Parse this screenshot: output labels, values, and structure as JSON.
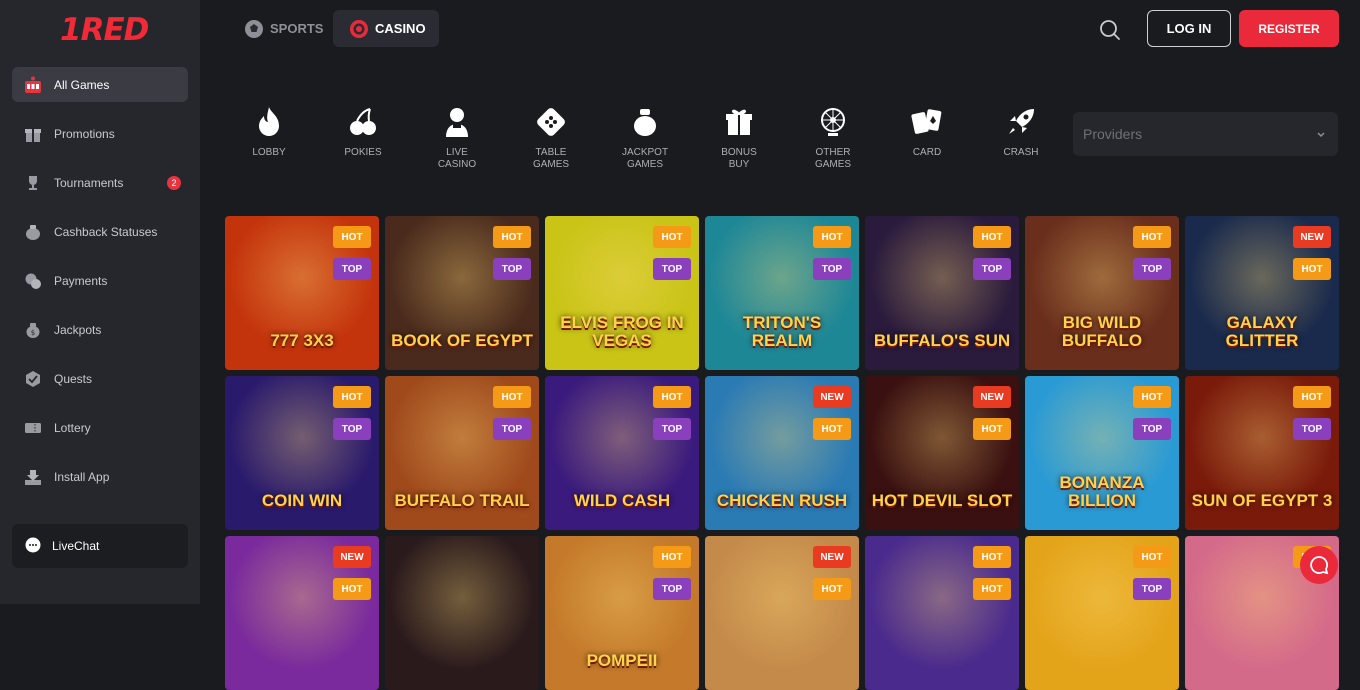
{
  "brand": {
    "logo_text": "1RED",
    "accent": "#ea2a3b"
  },
  "sidebar": {
    "items": [
      {
        "label": "All Games",
        "icon": "slot-machine-icon",
        "active": true
      },
      {
        "label": "Promotions",
        "icon": "gift-icon"
      },
      {
        "label": "Tournaments",
        "icon": "trophy-icon",
        "badge": "2"
      },
      {
        "label": "Cashback Statuses",
        "icon": "money-bag-icon"
      },
      {
        "label": "Payments",
        "icon": "coins-icon"
      },
      {
        "label": "Jackpots",
        "icon": "jackpot-bag-icon"
      },
      {
        "label": "Quests",
        "icon": "quest-badge-icon"
      },
      {
        "label": "Lottery",
        "icon": "ticket-icon"
      },
      {
        "label": "Install App",
        "icon": "download-icon"
      }
    ],
    "livechat": "LiveChat"
  },
  "topbar": {
    "tabs": [
      {
        "label": "SPORTS",
        "icon": "soccer-ball-icon"
      },
      {
        "label": "CASINO",
        "icon": "casino-chip-icon",
        "active": true
      }
    ],
    "login": "LOG IN",
    "register": "REGISTER"
  },
  "categories": [
    {
      "label": "LOBBY",
      "icon": "flame-icon"
    },
    {
      "label": "POKIES",
      "icon": "cherries-icon"
    },
    {
      "label": "LIVE CASINO",
      "icon": "dealer-icon"
    },
    {
      "label": "TABLE GAMES",
      "icon": "roulette-icon"
    },
    {
      "label": "JACKPOT GAMES",
      "icon": "jackpot-icon"
    },
    {
      "label": "BONUS BUY",
      "icon": "gift-box-icon"
    },
    {
      "label": "OTHER GAMES",
      "icon": "wheel-icon"
    },
    {
      "label": "CARD",
      "icon": "cards-icon"
    },
    {
      "label": "CRASH",
      "icon": "rocket-icon"
    }
  ],
  "providers": {
    "placeholder": "Providers"
  },
  "games": [
    {
      "title": "777 3X3",
      "tags": [
        "HOT",
        "TOP"
      ],
      "bg": "#c4340c"
    },
    {
      "title": "BOOK OF EGYPT",
      "tags": [
        "HOT",
        "TOP"
      ],
      "bg": "#4a2a1c"
    },
    {
      "title": "ELVIS FROG IN VEGAS",
      "tags": [
        "HOT",
        "TOP"
      ],
      "bg": "#c9c416"
    },
    {
      "title": "TRITON'S REALM",
      "tags": [
        "HOT",
        "TOP"
      ],
      "bg": "#1e8796"
    },
    {
      "title": "BUFFALO'S SUN",
      "tags": [
        "HOT",
        "TOP"
      ],
      "bg": "#2a1a3c"
    },
    {
      "title": "BIG WILD BUFFALO",
      "tags": [
        "HOT",
        "TOP"
      ],
      "bg": "#6a2e1c"
    },
    {
      "title": "GALAXY GLITTER",
      "tags": [
        "NEW",
        "HOT"
      ],
      "bg": "#1a2a4c"
    },
    {
      "title": "COIN WIN",
      "tags": [
        "HOT",
        "TOP"
      ],
      "bg": "#2a1a6c"
    },
    {
      "title": "BUFFALO TRAIL",
      "tags": [
        "HOT",
        "TOP"
      ],
      "bg": "#a04a1c"
    },
    {
      "title": "WILD CASH",
      "tags": [
        "HOT",
        "TOP"
      ],
      "bg": "#3a1a7c"
    },
    {
      "title": "CHICKEN RUSH",
      "tags": [
        "NEW",
        "HOT"
      ],
      "bg": "#2a7ab4"
    },
    {
      "title": "HOT DEVIL SLOT",
      "tags": [
        "NEW",
        "HOT"
      ],
      "bg": "#3a1010"
    },
    {
      "title": "BONANZA BILLION",
      "tags": [
        "HOT",
        "TOP"
      ],
      "bg": "#2a9ad4"
    },
    {
      "title": "SUN OF EGYPT 3",
      "tags": [
        "HOT",
        "TOP"
      ],
      "bg": "#7a1a0a"
    },
    {
      "title": "",
      "tags": [
        "NEW",
        "HOT"
      ],
      "bg": "#7a2a9c"
    },
    {
      "title": "",
      "tags": [],
      "bg": "#2a1a1c"
    },
    {
      "title": "POMPEII",
      "tags": [
        "HOT",
        "TOP"
      ],
      "bg": "#c47a2a"
    },
    {
      "title": "",
      "tags": [
        "NEW",
        "HOT"
      ],
      "bg": "#c48a4a"
    },
    {
      "title": "",
      "tags": [
        "HOT",
        "HOT"
      ],
      "bg": "#4a2a8c"
    },
    {
      "title": "",
      "tags": [
        "HOT",
        "TOP"
      ],
      "bg": "#e4a41a"
    },
    {
      "title": "",
      "tags": [
        "HOT"
      ],
      "bg": "#d46a8a"
    }
  ]
}
